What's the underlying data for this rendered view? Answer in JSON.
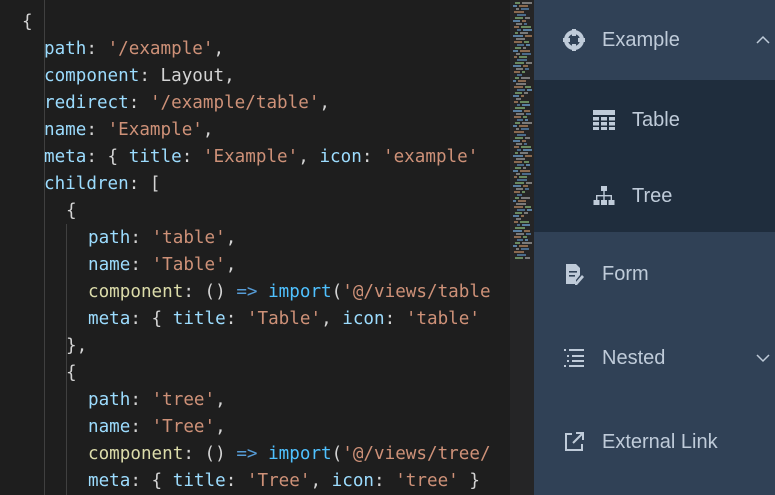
{
  "editor": {
    "lines": [
      [
        [
          "p",
          "{"
        ]
      ],
      [
        [
          "k",
          "path"
        ],
        [
          "p",
          ": "
        ],
        [
          "s",
          "'/example'"
        ],
        [
          "p",
          ","
        ]
      ],
      [
        [
          "k",
          "component"
        ],
        [
          "p",
          ": Layout,"
        ]
      ],
      [
        [
          "k",
          "redirect"
        ],
        [
          "p",
          ": "
        ],
        [
          "s",
          "'/example/table'"
        ],
        [
          "p",
          ","
        ]
      ],
      [
        [
          "k",
          "name"
        ],
        [
          "p",
          ": "
        ],
        [
          "s",
          "'Example'"
        ],
        [
          "p",
          ","
        ]
      ],
      [
        [
          "k",
          "meta"
        ],
        [
          "p",
          ": { "
        ],
        [
          "k",
          "title"
        ],
        [
          "p",
          ": "
        ],
        [
          "s",
          "'Example'"
        ],
        [
          "p",
          ", "
        ],
        [
          "k",
          "icon"
        ],
        [
          "p",
          ": "
        ],
        [
          "s",
          "'example'"
        ]
      ],
      [
        [
          "k",
          "children"
        ],
        [
          "p",
          ": ["
        ]
      ],
      [
        [
          "p",
          "{"
        ]
      ],
      [
        [
          "k",
          "path"
        ],
        [
          "p",
          ": "
        ],
        [
          "s",
          "'table'"
        ],
        [
          "p",
          ","
        ]
      ],
      [
        [
          "k",
          "name"
        ],
        [
          "p",
          ": "
        ],
        [
          "s",
          "'Table'"
        ],
        [
          "p",
          ","
        ]
      ],
      [
        [
          "f",
          "component"
        ],
        [
          "p",
          ": () "
        ],
        [
          "kw",
          "=>"
        ],
        [
          "p",
          " "
        ],
        [
          "im",
          "import"
        ],
        [
          "p",
          "("
        ],
        [
          "s",
          "'@/views/table"
        ]
      ],
      [
        [
          "k",
          "meta"
        ],
        [
          "p",
          ": { "
        ],
        [
          "k",
          "title"
        ],
        [
          "p",
          ": "
        ],
        [
          "s",
          "'Table'"
        ],
        [
          "p",
          ", "
        ],
        [
          "k",
          "icon"
        ],
        [
          "p",
          ": "
        ],
        [
          "s",
          "'table'"
        ]
      ],
      [
        [
          "p",
          "},"
        ]
      ],
      [
        [
          "p",
          "{"
        ]
      ],
      [
        [
          "k",
          "path"
        ],
        [
          "p",
          ": "
        ],
        [
          "s",
          "'tree'"
        ],
        [
          "p",
          ","
        ]
      ],
      [
        [
          "k",
          "name"
        ],
        [
          "p",
          ": "
        ],
        [
          "s",
          "'Tree'"
        ],
        [
          "p",
          ","
        ]
      ],
      [
        [
          "f",
          "component"
        ],
        [
          "p",
          ": () "
        ],
        [
          "kw",
          "=>"
        ],
        [
          "p",
          " "
        ],
        [
          "im",
          "import"
        ],
        [
          "p",
          "("
        ],
        [
          "s",
          "'@/views/tree/"
        ]
      ],
      [
        [
          "k",
          "meta"
        ],
        [
          "p",
          ": { "
        ],
        [
          "k",
          "title"
        ],
        [
          "p",
          ": "
        ],
        [
          "s",
          "'Tree'"
        ],
        [
          "p",
          ", "
        ],
        [
          "k",
          "icon"
        ],
        [
          "p",
          ": "
        ],
        [
          "s",
          "'tree'"
        ],
        [
          "p",
          " }"
        ]
      ]
    ]
  },
  "sidebar": {
    "items": [
      {
        "label": "Example",
        "icon": "example-icon",
        "arrow": "up"
      },
      {
        "label": "Table",
        "icon": "table-icon"
      },
      {
        "label": "Tree",
        "icon": "tree-icon"
      },
      {
        "label": "Form",
        "icon": "form-icon"
      },
      {
        "label": "Nested",
        "icon": "nested-icon",
        "arrow": "down"
      },
      {
        "label": "External Link",
        "icon": "external-link-icon"
      }
    ]
  },
  "colors": {
    "sidebar_bg": "#304156",
    "submenu_bg": "#1f2d3d",
    "menu_text": "#bfcbd9",
    "editor_bg": "#1e1e1e"
  }
}
